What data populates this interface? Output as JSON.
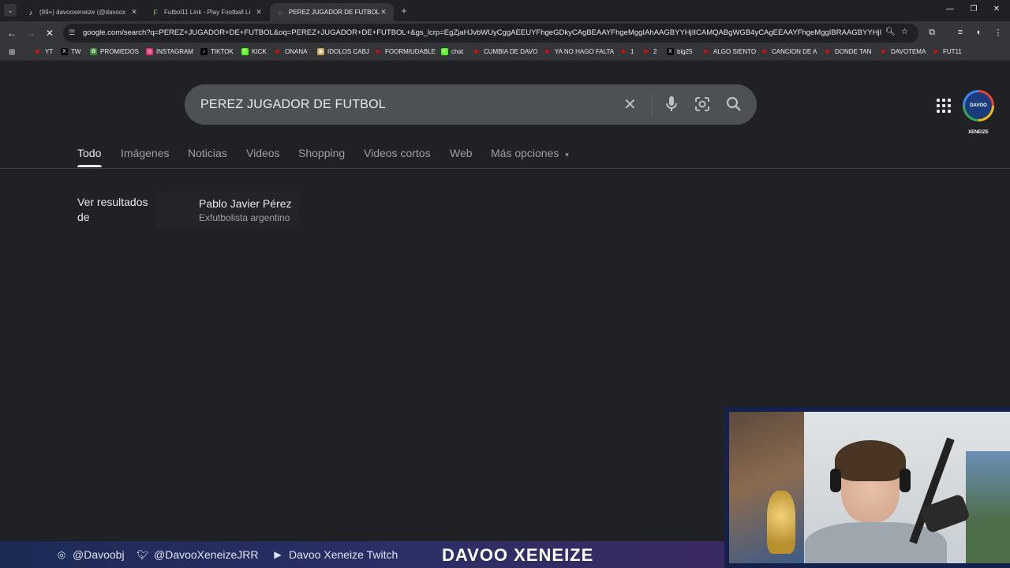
{
  "browser": {
    "tabs": [
      {
        "title": "(99+) davooxeneize (@davoox",
        "icon": "tiktok-icon",
        "active": false
      },
      {
        "title": "Futbol11 Link - Play Football Li",
        "icon": "futbol11-icon",
        "active": false
      },
      {
        "title": "PEREZ JUGADOR DE FUTBOL -",
        "icon": "loading-icon",
        "active": true
      }
    ],
    "url": "google.com/search?q=PEREZ+JUGADOR+DE+FUTBOL&oq=PEREZ+JUGADOR+DE+FUTBOL+&gs_lcrp=EgZjaHJvbWUyCggAEEUYFhgeGDkyCAgBEAAYFhgeMggIAhAAGBYYHjIICAMQABgWGB4yCAgEEAAYFhgeMggIBRAAGBYYHjIICAYQABgWGB...",
    "bookmarks": [
      {
        "label": "YT",
        "icon": "youtube-icon",
        "color": "#ff0000"
      },
      {
        "label": "TW",
        "icon": "x-icon",
        "color": "#000000"
      },
      {
        "label": "PROMIEDOS",
        "icon": "promiedos-icon",
        "color": "#3c8d2f"
      },
      {
        "label": "INSTAGRAM",
        "icon": "instagram-icon",
        "color": "#e1306c"
      },
      {
        "label": "TIKTOK",
        "icon": "tiktok-icon",
        "color": "#000000"
      },
      {
        "label": "KICK",
        "icon": "kick-icon",
        "color": "#53fc18"
      },
      {
        "label": "ONANA",
        "icon": "youtube-icon",
        "color": "#ff0000"
      },
      {
        "label": "IDOLOS CABJ",
        "icon": "page-icon",
        "color": "#c8a24a"
      },
      {
        "label": "FOORMIUDABLE",
        "icon": "youtube-icon",
        "color": "#ff0000"
      },
      {
        "label": "chat",
        "icon": "kick-icon",
        "color": "#53fc18"
      },
      {
        "label": "CUMBIA DE DAVO",
        "icon": "youtube-icon",
        "color": "#ff0000"
      },
      {
        "label": "YA NO HAGO FALTA",
        "icon": "youtube-icon",
        "color": "#ff0000"
      },
      {
        "label": "1",
        "icon": "youtube-icon",
        "color": "#ff0000"
      },
      {
        "label": "2",
        "icon": "youtube-icon",
        "color": "#ff0000"
      },
      {
        "label": "big25",
        "icon": "x-icon",
        "color": "#000000"
      },
      {
        "label": "ALGO SIENTO",
        "icon": "youtube-icon",
        "color": "#ff0000"
      },
      {
        "label": "CANCION DE A",
        "icon": "youtube-icon",
        "color": "#ff0000"
      },
      {
        "label": "DONDE TAN",
        "icon": "youtube-icon",
        "color": "#ff0000"
      },
      {
        "label": "DAVOTEMA",
        "icon": "youtube-icon",
        "color": "#ff0000"
      },
      {
        "label": "FUT11",
        "icon": "youtube-icon",
        "color": "#ff0000"
      }
    ]
  },
  "search": {
    "query": "PEREZ JUGADOR DE FUTBOL"
  },
  "nav_tabs": [
    {
      "label": "Todo",
      "active": true
    },
    {
      "label": "Imágenes",
      "active": false
    },
    {
      "label": "Noticias",
      "active": false
    },
    {
      "label": "Videos",
      "active": false
    },
    {
      "label": "Shopping",
      "active": false
    },
    {
      "label": "Videos cortos",
      "active": false
    },
    {
      "label": "Web",
      "active": false
    },
    {
      "label": "Más opciones",
      "active": false
    }
  ],
  "see_results": {
    "label": "Ver resultados de",
    "entity_name": "Pablo Javier Pérez",
    "entity_desc": "Exfutbolista argentino"
  },
  "stream_overlay": {
    "instagram": "@Davoobj",
    "twitter": "@DavooXeneizeJRR",
    "youtube": "Davoo Xeneize Twitch",
    "brand": "DAVOO XENEIZE"
  },
  "avatar_text": "DAVOO XENEIZE"
}
